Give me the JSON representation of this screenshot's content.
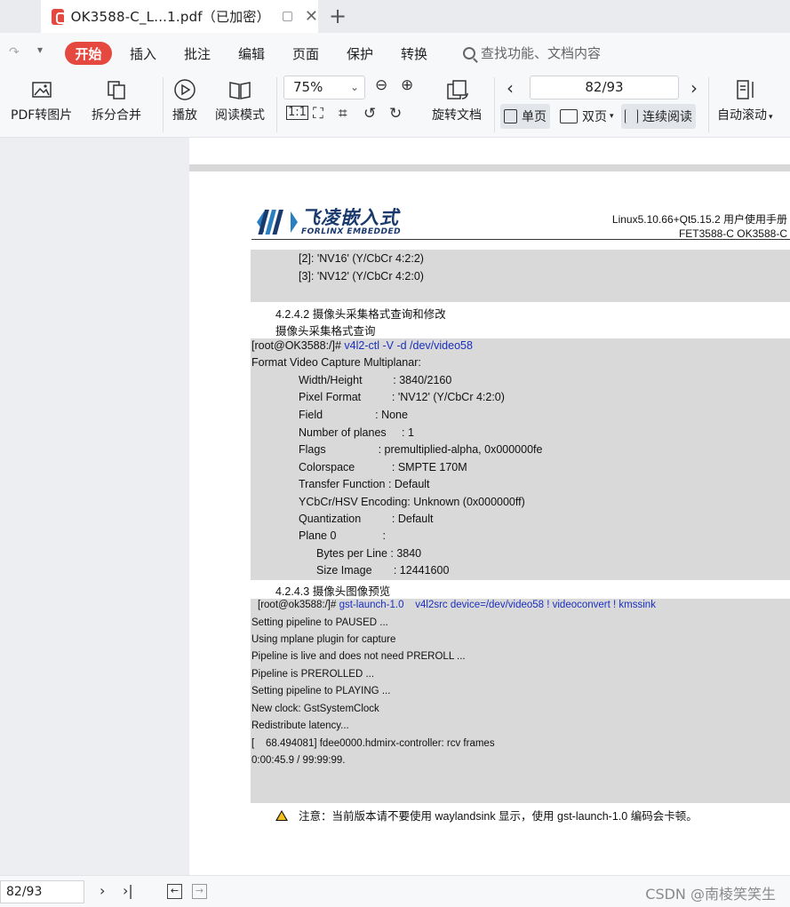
{
  "tab": {
    "title": "OK3588-C_L...1.pdf（已加密）",
    "new_tab": "+"
  },
  "menu": {
    "start": "开始",
    "items": [
      "插入",
      "批注",
      "编辑",
      "页面",
      "保护",
      "转换"
    ],
    "search_placeholder": "查找功能、文档内容"
  },
  "toolbar": {
    "pdf_to_image": "PDF转图片",
    "split_merge": "拆分合并",
    "play": "播放",
    "read_mode": "阅读模式",
    "zoom": "75%",
    "rotate": "旋转文档",
    "page_input": "82/93",
    "single_page": "单页",
    "double_page": "双页",
    "continuous": "连续阅读",
    "auto_scroll": "自动滚动"
  },
  "doc": {
    "logo_cn": "飞凌嵌入式",
    "logo_en": "FORLINX EMBEDDED",
    "header_line1": "Linux5.10.66+Qt5.15.2 用户使用手册",
    "header_line2": "FET3588-C    OK3588-C",
    "block1": [
      "[2]: 'NV16' (Y/CbCr 4:2:2)",
      "[3]: 'NV12' (Y/CbCr 4:2:0)"
    ],
    "section_4242": "4.2.4.2 摄像头采集格式查询和修改",
    "section_4242_sub": "摄像头采集格式查询",
    "cmd1_prompt": "[root@OK3588:/]#",
    "cmd1": " v4l2-ctl -V -d /dev/video58",
    "fmt_title": "Format Video Capture Multiplanar:",
    "fmt": [
      "Width/Height          : 3840/2160",
      "Pixel Format          : 'NV12' (Y/CbCr 4:2:0)",
      "Field                 : None",
      "Number of planes     : 1",
      "Flags                 : premultiplied-alpha, 0x000000fe",
      "Colorspace            : SMPTE 170M",
      "Transfer Function : Default",
      "YCbCr/HSV Encoding: Unknown (0x000000ff)",
      "Quantization          : Default",
      "Plane 0               :"
    ],
    "plane": [
      "Bytes per Line : 3840",
      "Size Image       : 12441600"
    ],
    "section_4243": "4.2.4.3 摄像头图像预览",
    "cmd2_prompt": "[root@ok3588:/]# ",
    "cmd2": "gst-launch-1.0    v4l2src device=/dev/video58 ! videoconvert ! kmssink",
    "out": [
      "Setting pipeline to PAUSED ...",
      "Using mplane plugin for capture",
      "Pipeline is live and does not need PREROLL ...",
      "Pipeline is PREROLLED ...",
      "Setting pipeline to PLAYING ...",
      "New clock: GstSystemClock",
      "Redistribute latency...",
      "[    68.494081] fdee0000.hdmirx-controller: rcv frames",
      "0:00:45.9 / 99:99:99."
    ],
    "note": "注意：当前版本请不要使用 waylandsink 显示，使用 gst-launch-1.0 编码会卡顿。"
  },
  "status": {
    "page": "82/93",
    "watermark": "CSDN @南棱笑笑生"
  }
}
